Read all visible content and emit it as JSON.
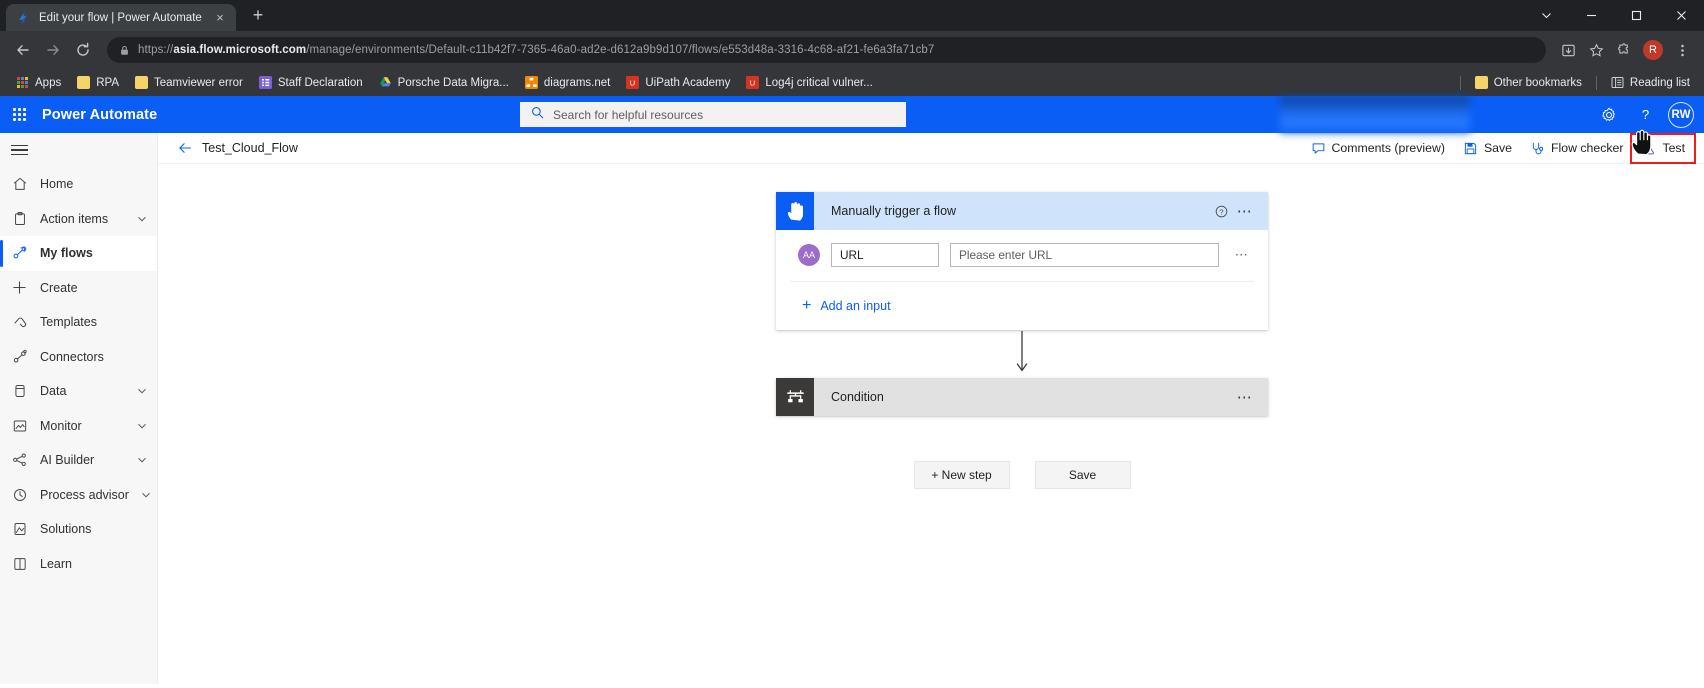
{
  "browser": {
    "tab": {
      "title": "Edit your flow | Power Automate",
      "favicon": "power-automate-icon",
      "close": "×"
    },
    "new_tab": "+",
    "window_controls": {
      "minimize": "–",
      "maximize": "□",
      "close": "✕",
      "chevron": "⌄"
    },
    "nav": {
      "back": "←",
      "forward": "→",
      "reload": "⟳"
    },
    "url": {
      "scheme": "https://",
      "host": "asia.flow.microsoft.com",
      "path": "/manage/environments/Default-c11b42f7-7365-46a0-ad2e-d612a9b9d107/flows/e553d48a-3316-4c68-af21-fe6a3fa71cb7"
    },
    "toolbar_icons": [
      "install-app-icon",
      "bookmark-star-icon",
      "extensions-puzzle-icon",
      "profile-avatar",
      "more-menu-icon"
    ],
    "profile_initial": "R",
    "bookmarks": [
      {
        "label": "Apps",
        "icon": "apps-grid-icon",
        "color": "#e8e8e8"
      },
      {
        "label": "RPA",
        "icon": "folder-icon",
        "color": "#f5d36b"
      },
      {
        "label": "Teamviewer error",
        "icon": "folder-icon",
        "color": "#f5d36b"
      },
      {
        "label": "Staff Declaration",
        "icon": "form-icon",
        "color": "#7b5fd4"
      },
      {
        "label": "Porsche Data Migra...",
        "icon": "google-drive-icon",
        "color": "#2aa84a"
      },
      {
        "label": "diagrams.net",
        "icon": "diagrams-icon",
        "color": "#f08705"
      },
      {
        "label": "UiPath Academy",
        "icon": "uipath-icon",
        "color": "#d4341f"
      },
      {
        "label": "Log4j critical vulner...",
        "icon": "uipath-icon",
        "color": "#d4341f"
      }
    ],
    "bookmarks_right": [
      {
        "label": "Other bookmarks",
        "icon": "folder-icon"
      },
      {
        "label": "Reading list",
        "icon": "reading-list-icon"
      }
    ]
  },
  "suitebar": {
    "waffle": "app-launcher-icon",
    "brand": "Power Automate",
    "search": {
      "placeholder": "Search for helpful resources",
      "icon": "search-icon"
    },
    "settings_icon": "gear-icon",
    "help_icon": "help-question-icon",
    "user_initials": "RW",
    "accent": "#0a5ef5"
  },
  "sidebar": {
    "menu_toggle": "hamburger-icon",
    "items": [
      {
        "label": "Home",
        "icon": "home-icon",
        "expandable": false,
        "selected": false
      },
      {
        "label": "Action items",
        "icon": "clipboard-icon",
        "expandable": true,
        "selected": false
      },
      {
        "label": "My flows",
        "icon": "flow-icon",
        "expandable": false,
        "selected": true
      },
      {
        "label": "Create",
        "icon": "plus-icon",
        "expandable": false,
        "selected": false
      },
      {
        "label": "Templates",
        "icon": "templates-icon",
        "expandable": false,
        "selected": false
      },
      {
        "label": "Connectors",
        "icon": "connectors-icon",
        "expandable": false,
        "selected": false
      },
      {
        "label": "Data",
        "icon": "database-icon",
        "expandable": true,
        "selected": false
      },
      {
        "label": "Monitor",
        "icon": "monitor-icon",
        "expandable": true,
        "selected": false
      },
      {
        "label": "AI Builder",
        "icon": "ai-builder-icon",
        "expandable": true,
        "selected": false
      },
      {
        "label": "Process advisor",
        "icon": "process-advisor-icon",
        "expandable": true,
        "selected": false
      },
      {
        "label": "Solutions",
        "icon": "solutions-icon",
        "expandable": false,
        "selected": false
      },
      {
        "label": "Learn",
        "icon": "book-icon",
        "expandable": false,
        "selected": false
      }
    ]
  },
  "designer": {
    "back_icon": "back-arrow-icon",
    "flow_name": "Test_Cloud_Flow",
    "commands": [
      {
        "label": "Comments (preview)",
        "icon": "comment-icon"
      },
      {
        "label": "Save",
        "icon": "save-disk-icon"
      },
      {
        "label": "Flow checker",
        "icon": "stethoscope-icon"
      }
    ],
    "test_button": {
      "label": "Test",
      "icon": "flask-icon",
      "highlighted": true,
      "highlight_color": "#f21b1b"
    },
    "cursor": "hand-pointer-cursor"
  },
  "flow": {
    "trigger": {
      "title": "Manually trigger a flow",
      "icon": "manual-trigger-hand-icon",
      "help_icon": "help-circle-icon",
      "more_icon": "ellipsis-icon",
      "inputs": [
        {
          "avatar": "AA",
          "avatar_name": "text-input-icon",
          "name_value": "URL",
          "value_placeholder": "Please enter URL",
          "more_icon": "ellipsis-icon"
        }
      ],
      "add_input": {
        "label": "Add an input",
        "icon": "plus-icon"
      }
    },
    "connector_icon": "down-arrow-connector",
    "action": {
      "title": "Condition",
      "icon": "condition-icon",
      "more_icon": "ellipsis-icon"
    },
    "buttons": [
      {
        "label": "+ New step",
        "name": "new-step-button"
      },
      {
        "label": "Save",
        "name": "save-flow-button"
      }
    ]
  }
}
